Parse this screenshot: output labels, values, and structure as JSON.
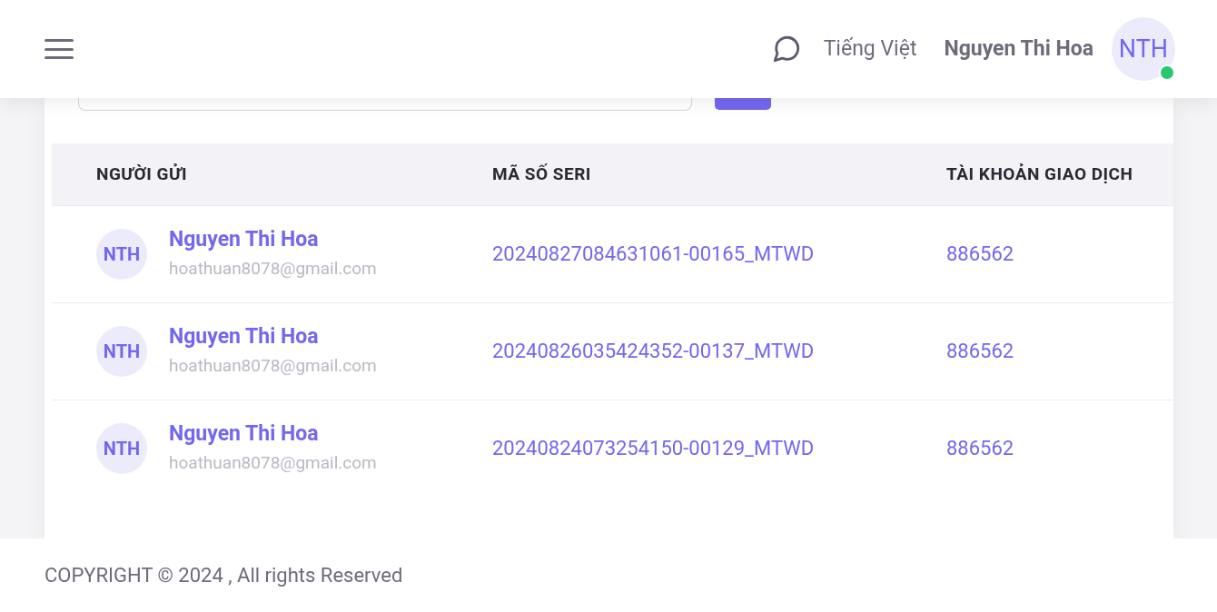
{
  "header": {
    "language": "Tiếng Việt",
    "user_name": "Nguyen Thi Hoa",
    "avatar_initials": "NTH",
    "online": true
  },
  "table": {
    "columns": [
      "NGƯỜI GỬI",
      "MÃ SỐ SERI",
      "TÀI KHOẢN GIAO DỊCH"
    ],
    "rows": [
      {
        "initials": "NTH",
        "name": "Nguyen Thi Hoa",
        "email": "hoathuan8078@gmail.com",
        "serial": "20240827084631061-00165_MTWD",
        "account": "886562"
      },
      {
        "initials": "NTH",
        "name": "Nguyen Thi Hoa",
        "email": "hoathuan8078@gmail.com",
        "serial": "20240826035424352-00137_MTWD",
        "account": "886562"
      },
      {
        "initials": "NTH",
        "name": "Nguyen Thi Hoa",
        "email": "hoathuan8078@gmail.com",
        "serial": "20240824073254150-00129_MTWD",
        "account": "886562"
      }
    ]
  },
  "footer": {
    "copyright": "COPYRIGHT © 2024 , All rights Reserved"
  }
}
